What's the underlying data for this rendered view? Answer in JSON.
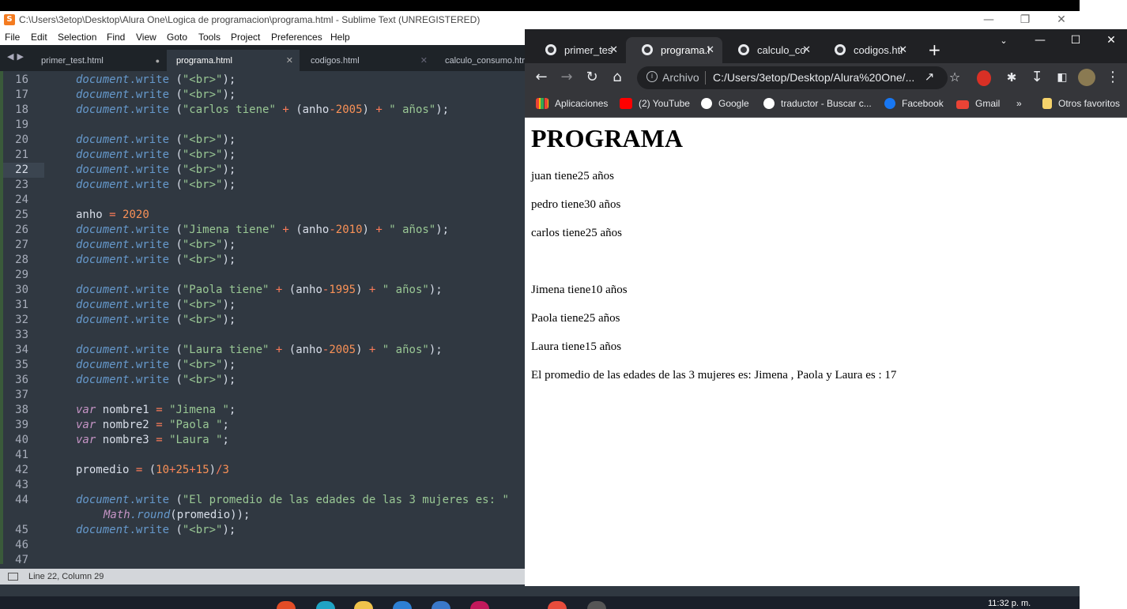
{
  "sublime": {
    "title": "C:\\Users\\3etop\\Desktop\\Alura One\\Logica de programacion\\programa.html - Sublime Text (UNREGISTERED)",
    "menu": [
      "File",
      "Edit",
      "Selection",
      "Find",
      "View",
      "Goto",
      "Tools",
      "Project",
      "Preferences",
      "Help"
    ],
    "tabs": [
      {
        "label": "primer_test.html",
        "state": "modified"
      },
      {
        "label": "programa.html",
        "state": "active"
      },
      {
        "label": "codigos.html",
        "state": "inactive"
      },
      {
        "label": "calculo_consumo.html",
        "state": "inactive"
      }
    ],
    "status": "Line 22, Column 29",
    "current_line": 22,
    "line_numbers": [
      "16",
      "17",
      "18",
      "19",
      "20",
      "21",
      "22",
      "23",
      "24",
      "25",
      "26",
      "27",
      "28",
      "29",
      "30",
      "31",
      "32",
      "33",
      "34",
      "35",
      "36",
      "37",
      "38",
      "39",
      "40",
      "41",
      "42",
      "43",
      "44",
      "",
      "45",
      "46",
      "47"
    ],
    "code": {
      "doc": "document",
      "write": ".write",
      "br": "\"<br>\"",
      "carlos": "\"carlos tiene\"",
      "jimena": "\"Jimena tiene\"",
      "paola": "\"Paola tiene\"",
      "laura": "\"Laura tiene\"",
      "anos": "\" años\"",
      "anho": "anho",
      "y2005": "2005",
      "y2010": "2010",
      "y1995": "1995",
      "y2020": "2020",
      "var": "var",
      "nombre1": "nombre1",
      "nombre2": "nombre2",
      "nombre3": "nombre3",
      "s_jimena": "\"Jimena \"",
      "s_paola": "\"Paola \"",
      "s_laura": "\"Laura \"",
      "promedio": "promedio",
      "n10": "10",
      "n25": "25",
      "n15": "15",
      "n3": "3",
      "promedio_str": "\"El promedio de las edades de las 3 mujeres es: \"",
      "math": "Math",
      "round": ".round"
    }
  },
  "taskbar": {
    "clock": "11:32 p. m."
  },
  "chrome": {
    "tabs": [
      {
        "label": "primer_test"
      },
      {
        "label": "programa.h"
      },
      {
        "label": "calculo_co"
      },
      {
        "label": "codigos.htm"
      }
    ],
    "omnibox": {
      "scheme": "Archivo",
      "url": "C:/Users/3etop/Desktop/Alura%20One/..."
    },
    "bookmarks": [
      {
        "label": "Aplicaciones",
        "color": "#ea4335"
      },
      {
        "label": "(2) YouTube",
        "color": "#ff0000"
      },
      {
        "label": "Google",
        "color": "#4285f4"
      },
      {
        "label": "traductor - Buscar c...",
        "color": "#4285f4"
      },
      {
        "label": "Facebook",
        "color": "#1877f2"
      },
      {
        "label": "Gmail",
        "color": "#ea4335"
      },
      {
        "label": "Otros favoritos",
        "color": "#f6d36b"
      }
    ],
    "more_bookmarks": "»",
    "page": {
      "heading": "PROGRAMA",
      "lines": [
        "juan tiene25 años",
        "pedro tiene30 años",
        "carlos tiene25 años",
        "Jimena tiene10 años",
        "Paola tiene25 años",
        "Laura tiene15 años",
        "El promedio de las edades de las 3 mujeres es: Jimena , Paola y Laura es : 17"
      ]
    }
  }
}
